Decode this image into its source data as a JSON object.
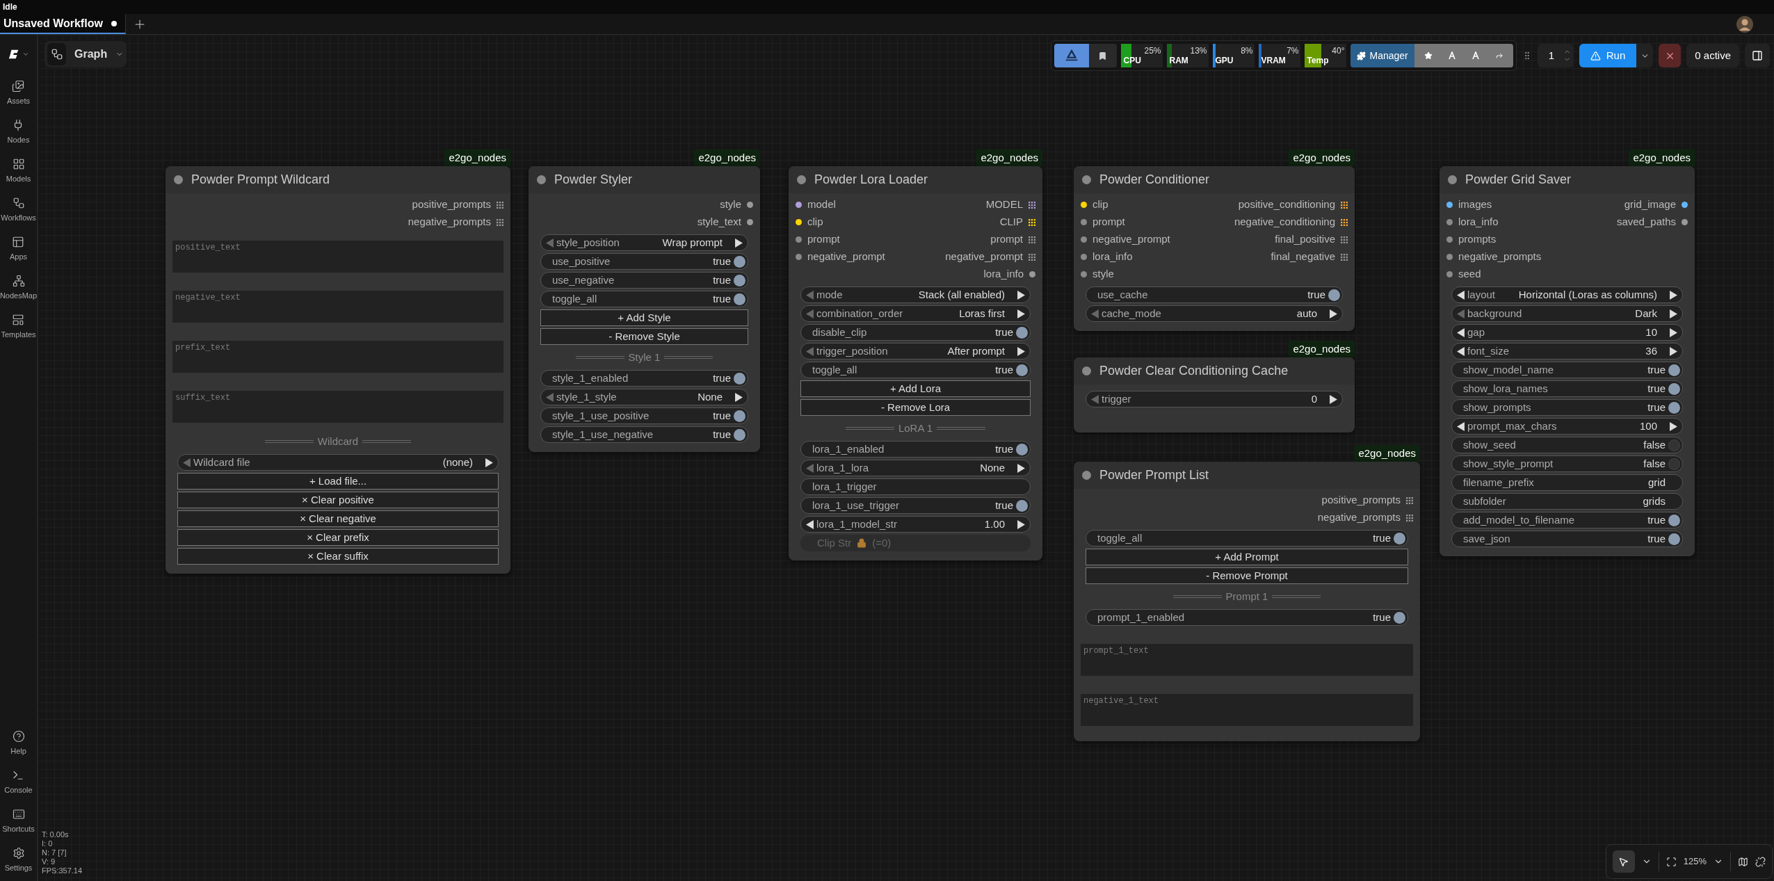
{
  "status": "Idle",
  "tabs": [
    {
      "label": "Unsaved Workflow",
      "selected": true,
      "unsaved": true
    }
  ],
  "sidebar": {
    "top": [
      {
        "label": "Assets"
      },
      {
        "label": "Nodes"
      },
      {
        "label": "Models"
      },
      {
        "label": "Workflows"
      },
      {
        "label": "Apps"
      },
      {
        "label": "NodesMap"
      },
      {
        "label": "Templates"
      }
    ],
    "bottom": [
      {
        "label": "Help"
      },
      {
        "label": "Console"
      },
      {
        "label": "Shortcuts"
      },
      {
        "label": "Settings"
      }
    ]
  },
  "graph_menu": {
    "label": "Graph"
  },
  "toolbar": {
    "meters": [
      {
        "label": "CPU",
        "reading": "25%",
        "level": 0.25,
        "color": "#1f9e1f"
      },
      {
        "label": "RAM",
        "reading": "13%",
        "level": 0.13,
        "color": "#17661a"
      },
      {
        "label": "GPU",
        "reading": "8%",
        "level": 0.08,
        "color": "#2a86e6"
      },
      {
        "label": "VRAM",
        "reading": "7%",
        "level": 0.07,
        "color": "#2468c4"
      },
      {
        "label": "Temp",
        "reading": "40°",
        "level": 0.4,
        "color": "#6a9c00"
      }
    ],
    "manager": "Manager",
    "queue_count": "1",
    "run": "Run",
    "active": "0 active"
  },
  "nodes": [
    {
      "title": "Powder Prompt Wildcard",
      "badge": "e2go_nodes",
      "outputs": [
        {
          "name": "positive_prompts",
          "kind": "grid",
          "color": "#9a9a9a"
        },
        {
          "name": "negative_prompts",
          "kind": "grid",
          "color": "#9a9a9a"
        }
      ],
      "widgets": [
        {
          "kind": "textarea",
          "placeholder": "positive_text"
        },
        {
          "kind": "textarea",
          "placeholder": "negative_text"
        },
        {
          "kind": "textarea",
          "placeholder": "prefix_text"
        },
        {
          "kind": "textarea",
          "placeholder": "suffix_text"
        },
        {
          "kind": "divider",
          "label": "Wildcard"
        },
        {
          "kind": "combo",
          "label": "Wildcard file",
          "value": "(none)",
          "left_disabled": true
        },
        {
          "kind": "button",
          "label": "+ Load file..."
        },
        {
          "kind": "button",
          "label": "× Clear positive"
        },
        {
          "kind": "button",
          "label": "× Clear negative"
        },
        {
          "kind": "button",
          "label": "× Clear prefix"
        },
        {
          "kind": "button",
          "label": "× Clear suffix"
        }
      ]
    },
    {
      "title": "Powder Styler",
      "badge": "e2go_nodes",
      "outputs": [
        {
          "name": "style",
          "kind": "dot",
          "color": "#9a9a9a"
        },
        {
          "name": "style_text",
          "kind": "dot",
          "color": "#9a9a9a"
        }
      ],
      "widgets": [
        {
          "kind": "combo",
          "label": "style_position",
          "value": "Wrap prompt",
          "left_disabled": true
        },
        {
          "kind": "toggle",
          "label": "use_positive",
          "value": "true",
          "on": true
        },
        {
          "kind": "toggle",
          "label": "use_negative",
          "value": "true",
          "on": true
        },
        {
          "kind": "toggle",
          "label": "toggle_all",
          "value": "true",
          "on": true
        },
        {
          "kind": "button",
          "label": "+ Add Style"
        },
        {
          "kind": "button",
          "label": "- Remove Style"
        },
        {
          "kind": "divider",
          "label": "Style 1"
        },
        {
          "kind": "toggle",
          "label": "style_1_enabled",
          "value": "true",
          "on": true
        },
        {
          "kind": "combo",
          "label": "style_1_style",
          "value": "None",
          "left_disabled": true
        },
        {
          "kind": "toggle",
          "label": "style_1_use_positive",
          "value": "true",
          "on": true
        },
        {
          "kind": "toggle",
          "label": "style_1_use_negative",
          "value": "true",
          "on": true
        }
      ]
    },
    {
      "title": "Powder Lora Loader",
      "badge": "e2go_nodes",
      "inputs": [
        {
          "name": "model",
          "color": "#b39ddb"
        },
        {
          "name": "clip",
          "color": "#ffd500"
        },
        {
          "name": "prompt",
          "color": "#8a8a8a"
        },
        {
          "name": "negative_prompt",
          "color": "#8a8a8a"
        }
      ],
      "outputs": [
        {
          "name": "MODEL",
          "kind": "grid",
          "color": "#b39ddb"
        },
        {
          "name": "CLIP",
          "kind": "grid",
          "color": "#ffd500"
        },
        {
          "name": "prompt",
          "kind": "grid",
          "color": "#9a9a9a"
        },
        {
          "name": "negative_prompt",
          "kind": "grid",
          "color": "#9a9a9a"
        },
        {
          "name": "lora_info",
          "kind": "dot",
          "color": "#9a9a9a"
        }
      ],
      "widgets": [
        {
          "kind": "combo",
          "label": "mode",
          "value": "Stack (all enabled)",
          "left_disabled": true
        },
        {
          "kind": "combo",
          "label": "combination_order",
          "value": "Loras first",
          "left_disabled": true
        },
        {
          "kind": "toggle",
          "label": "disable_clip",
          "value": "true",
          "on": true
        },
        {
          "kind": "combo",
          "label": "trigger_position",
          "value": "After prompt",
          "left_disabled": true
        },
        {
          "kind": "toggle",
          "label": "toggle_all",
          "value": "true",
          "on": true
        },
        {
          "kind": "button",
          "label": "+ Add Lora"
        },
        {
          "kind": "button",
          "label": "- Remove Lora"
        },
        {
          "kind": "divider",
          "label": "LoRA 1"
        },
        {
          "kind": "toggle",
          "label": "lora_1_enabled",
          "value": "true",
          "on": true
        },
        {
          "kind": "combo",
          "label": "lora_1_lora",
          "value": "None",
          "left_disabled": true
        },
        {
          "kind": "text",
          "label": "lora_1_trigger"
        },
        {
          "kind": "toggle",
          "label": "lora_1_use_trigger",
          "value": "true",
          "on": true
        },
        {
          "kind": "combo",
          "label": "lora_1_model_str",
          "value": "1.00",
          "left_disabled": false
        },
        {
          "kind": "locked",
          "label": "Clip Str",
          "note": "(=0)"
        }
      ]
    },
    {
      "title": "Powder Conditioner",
      "badge": "e2go_nodes",
      "inputs": [
        {
          "name": "clip",
          "color": "#ffd500"
        },
        {
          "name": "prompt",
          "color": "#8a8a8a"
        },
        {
          "name": "negative_prompt",
          "color": "#8a8a8a"
        },
        {
          "name": "lora_info",
          "color": "#8a8a8a"
        },
        {
          "name": "style",
          "color": "#8a8a8a"
        }
      ],
      "outputs": [
        {
          "name": "positive_conditioning",
          "kind": "grid",
          "color": "#ffa931"
        },
        {
          "name": "negative_conditioning",
          "kind": "grid",
          "color": "#ffa931"
        },
        {
          "name": "final_positive",
          "kind": "grid",
          "color": "#9a9a9a"
        },
        {
          "name": "final_negative",
          "kind": "grid",
          "color": "#9a9a9a"
        }
      ],
      "widgets": [
        {
          "kind": "toggle",
          "label": "use_cache",
          "value": "true",
          "on": true
        },
        {
          "kind": "combo",
          "label": "cache_mode",
          "value": "auto",
          "left_disabled": true
        }
      ]
    },
    {
      "title": "Powder Clear Conditioning Cache",
      "badge": "e2go_nodes",
      "widgets": [
        {
          "kind": "combo",
          "label": "trigger",
          "value": "0",
          "left_disabled": true
        }
      ]
    },
    {
      "title": "Powder Prompt List",
      "badge": "e2go_nodes",
      "outputs": [
        {
          "name": "positive_prompts",
          "kind": "grid",
          "color": "#9a9a9a"
        },
        {
          "name": "negative_prompts",
          "kind": "grid",
          "color": "#9a9a9a"
        }
      ],
      "widgets": [
        {
          "kind": "toggle",
          "label": "toggle_all",
          "value": "true",
          "on": true
        },
        {
          "kind": "button",
          "label": "+ Add Prompt"
        },
        {
          "kind": "button",
          "label": "- Remove Prompt"
        },
        {
          "kind": "divider",
          "label": "Prompt 1"
        },
        {
          "kind": "toggle",
          "label": "prompt_1_enabled",
          "value": "true",
          "on": true
        },
        {
          "kind": "textarea",
          "placeholder": "prompt_1_text"
        },
        {
          "kind": "textarea",
          "placeholder": "negative_1_text"
        }
      ]
    },
    {
      "title": "Powder Grid Saver",
      "badge": "e2go_nodes",
      "inputs": [
        {
          "name": "images",
          "color": "#64b5f6"
        },
        {
          "name": "lora_info",
          "color": "#8a8a8a"
        },
        {
          "name": "prompts",
          "color": "#8a8a8a"
        },
        {
          "name": "negative_prompts",
          "color": "#8a8a8a"
        },
        {
          "name": "seed",
          "color": "#8a8a8a"
        }
      ],
      "outputs": [
        {
          "name": "grid_image",
          "kind": "dot",
          "color": "#64b5f6"
        },
        {
          "name": "saved_paths",
          "kind": "dot",
          "color": "#9a9a9a"
        }
      ],
      "widgets": [
        {
          "kind": "combo",
          "label": "layout",
          "value": "Horizontal (Loras as columns)",
          "left_disabled": false
        },
        {
          "kind": "combo",
          "label": "background",
          "value": "Dark",
          "left_disabled": true
        },
        {
          "kind": "combo",
          "label": "gap",
          "value": "10",
          "left_disabled": false
        },
        {
          "kind": "combo",
          "label": "font_size",
          "value": "36",
          "left_disabled": false
        },
        {
          "kind": "toggle",
          "label": "show_model_name",
          "value": "true",
          "on": true
        },
        {
          "kind": "toggle",
          "label": "show_lora_names",
          "value": "true",
          "on": true
        },
        {
          "kind": "toggle",
          "label": "show_prompts",
          "value": "true",
          "on": true
        },
        {
          "kind": "combo",
          "label": "prompt_max_chars",
          "value": "100",
          "left_disabled": false
        },
        {
          "kind": "toggle",
          "label": "show_seed",
          "value": "false",
          "on": false
        },
        {
          "kind": "toggle",
          "label": "show_style_prompt",
          "value": "false",
          "on": false
        },
        {
          "kind": "text",
          "label": "filename_prefix",
          "value": "grid"
        },
        {
          "kind": "text",
          "label": "subfolder",
          "value": "grids"
        },
        {
          "kind": "toggle",
          "label": "add_model_to_filename",
          "value": "true",
          "on": true
        },
        {
          "kind": "toggle",
          "label": "save_json",
          "value": "true",
          "on": true
        }
      ]
    }
  ],
  "stats": [
    "T: 0.00s",
    "I: 0",
    "N: 7 [7]",
    "V: 9",
    "FPS:357.14"
  ],
  "canvas_tools": {
    "zoom": "125%"
  }
}
